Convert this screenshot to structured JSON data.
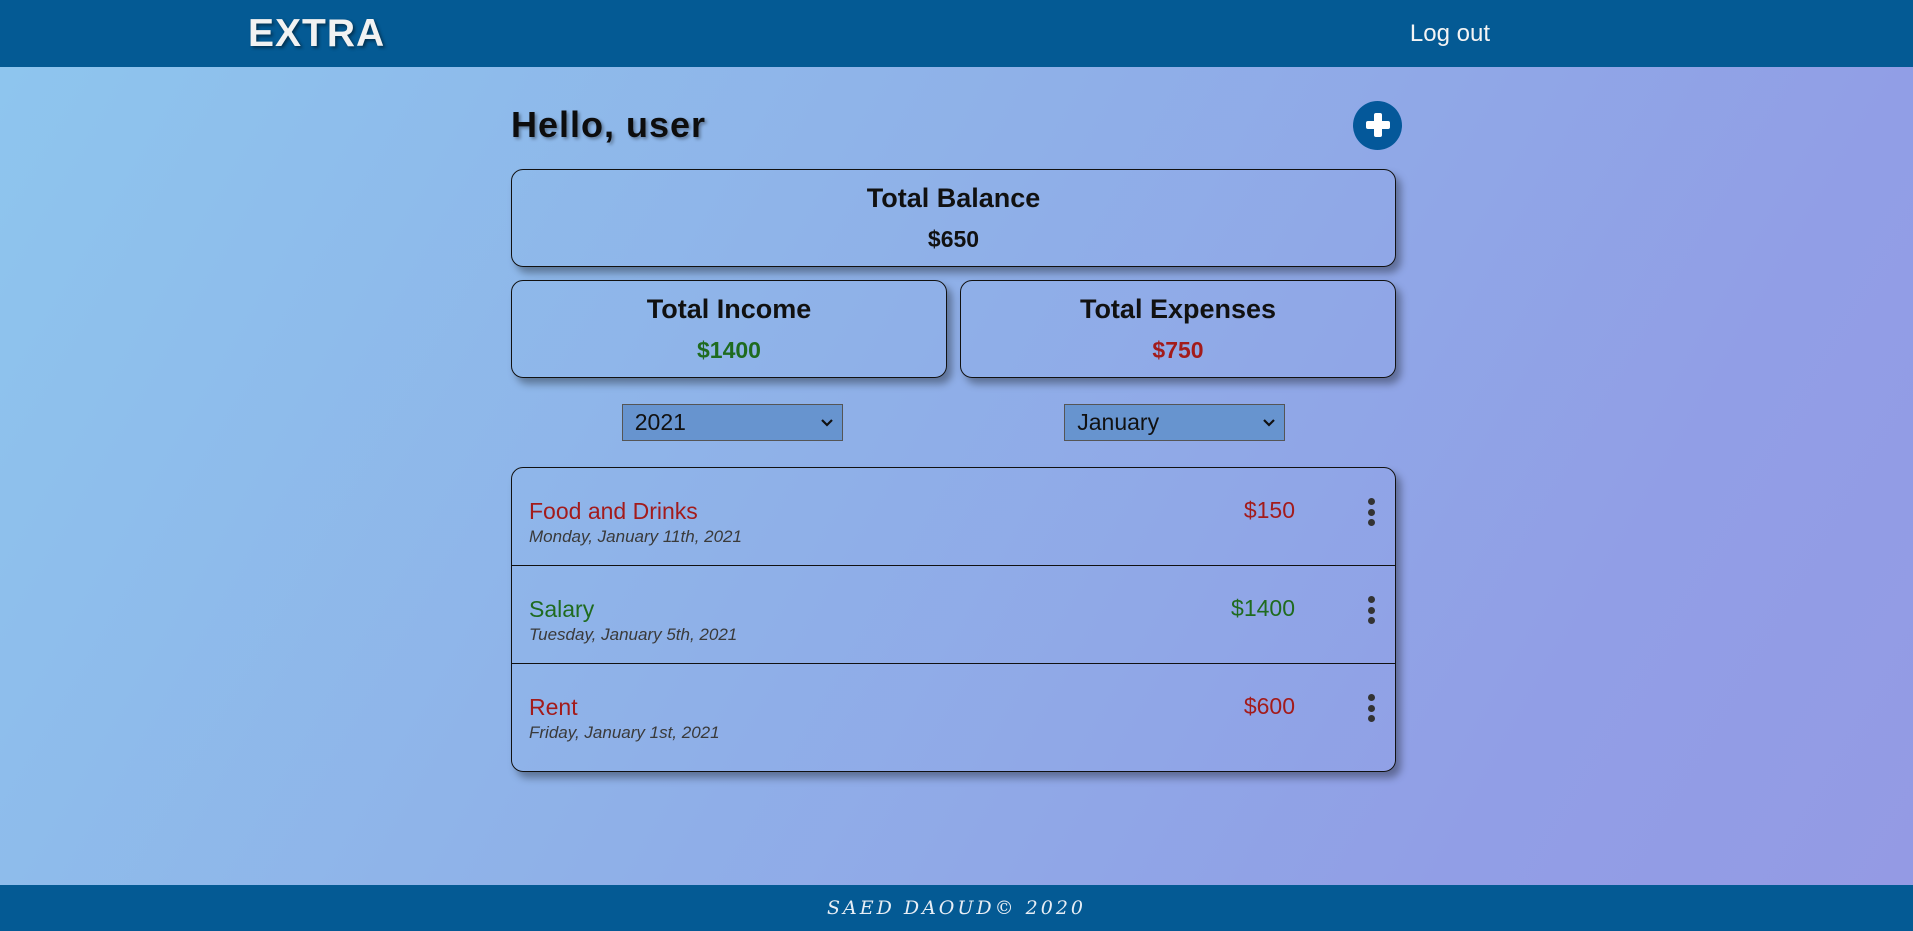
{
  "navbar": {
    "brand": "EXTRA",
    "logout_label": "Log out"
  },
  "greeting": "Hello, user",
  "add_icon": "plus-circle-icon",
  "balance": {
    "title": "Total Balance",
    "value": "$650"
  },
  "income": {
    "title": "Total Income",
    "value": "$1400",
    "color": "#1f6b1f"
  },
  "expenses": {
    "title": "Total Expenses",
    "value": "$750",
    "color": "#a31b1b"
  },
  "filters": {
    "year": "2021",
    "month": "January"
  },
  "transactions": [
    {
      "name": "Food and Drinks",
      "date": "Monday, January 11th, 2021",
      "amount": "$150",
      "type": "expense"
    },
    {
      "name": "Salary",
      "date": "Tuesday, January 5th, 2021",
      "amount": "$1400",
      "type": "income"
    },
    {
      "name": "Rent",
      "date": "Friday, January 1st, 2021",
      "amount": "$600",
      "type": "expense"
    }
  ],
  "footer": {
    "text": "SAED DAOUD© 2020"
  }
}
